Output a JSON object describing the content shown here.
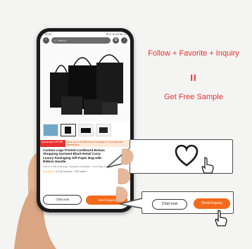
{
  "headline": {
    "line1": "Follow + Favorite + Inquiry",
    "equals": "II",
    "line2": "Get Free Sample"
  },
  "phone": {
    "status_time": "15:34",
    "status_right": "⊕ ⊙ ⊚ 5d 5d ▭",
    "search_placeholder": "Search",
    "promo_left": "Mastercard OFFER",
    "promo_right": "Save up to US $50 every Tuesday to Thursday with Mastercard",
    "product_title": "Custom Logo Printed Cardboard Boluas Shopping Garment Black Retail Carry Luxury Packaging Gift Paper Bag with Ribbon Handle",
    "product_sub": "Pay in 4 with Afterpay • Samples Available • Give Bag Service",
    "rating_stars": "★★★★★",
    "rating_text": "5.0 (5 reviews) · 150 orders",
    "chat_label": "Chat now",
    "send_label": "Send inquiry"
  },
  "callout": {
    "chat_label": "Chat now",
    "send_label": "Send inquiry"
  },
  "colors": {
    "accent_red": "#e8312f",
    "accent_orange": "#f26a1b",
    "background": "#f4f4f2"
  },
  "icons": [
    "heart-icon",
    "pointer-hand-icon",
    "send-icon",
    "back-arrow-icon",
    "search-icon",
    "share-icon",
    "more-icon"
  ]
}
